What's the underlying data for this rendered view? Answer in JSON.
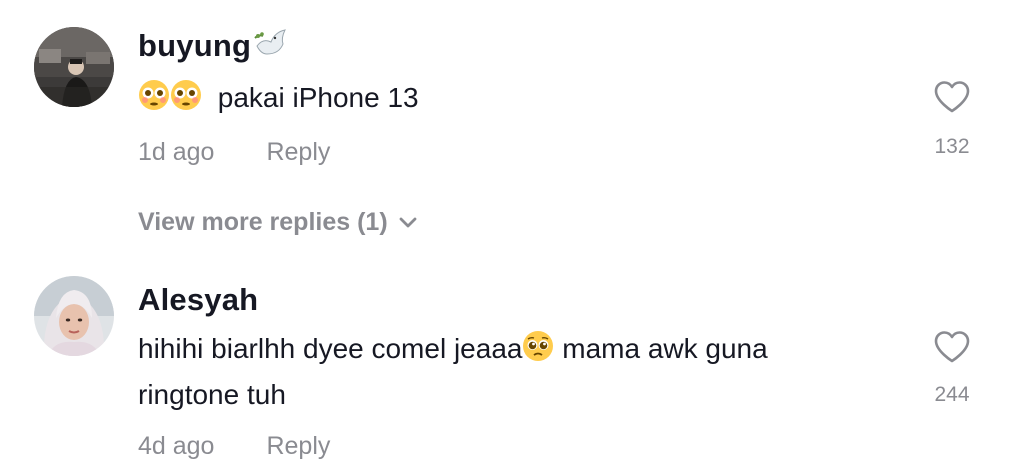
{
  "comments": [
    {
      "username": "buyung",
      "username_badge_icon": "dove-icon",
      "text_emoji": "flushed-face-emoji",
      "text": "pakai iPhone 13",
      "time": "1d ago",
      "reply_label": "Reply",
      "likes": "132"
    },
    {
      "username": "Alesyah",
      "text_line1": "hihihi biarlhh dyee comel jeaaa",
      "text_emoji": "pleading-face-emoji",
      "text_line1_end": " mama awk guna",
      "text_line2": "ringtone tuh",
      "time": "4d ago",
      "reply_label": "Reply",
      "likes": "244"
    }
  ],
  "view_more_replies": "View more replies (1)",
  "colors": {
    "text": "#161823",
    "muted": "#8a8b91",
    "background": "#ffffff"
  }
}
